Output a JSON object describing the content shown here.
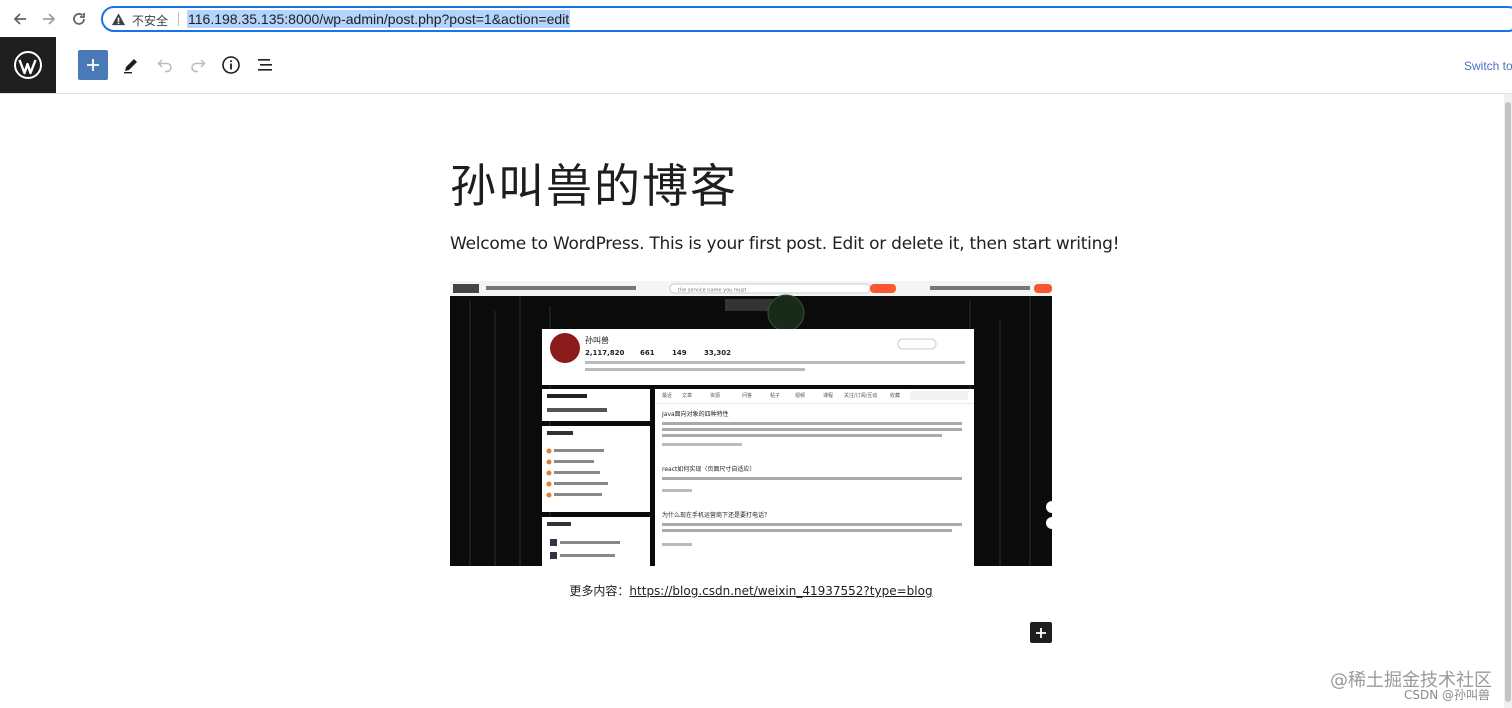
{
  "browser": {
    "security_label": "不安全",
    "url": "116.198.35.135:8000/wp-admin/post.php?post=1&action=edit"
  },
  "toolbar": {
    "switch_label": "Switch to"
  },
  "post": {
    "title": "孙叫兽的博客",
    "paragraph": "Welcome to WordPress. This is your first post. Edit or delete it, then start writing!",
    "caption_prefix": "更多内容：",
    "caption_link": "https://blog.csdn.net/weixin_41937552?type=blog"
  },
  "screenshot": {
    "search_placeholder": "the service name you must",
    "profile_name": "孙叫兽",
    "stats": [
      "2,117,820",
      "661",
      "149",
      "33,302"
    ],
    "tabs": [
      "最近",
      "文章",
      "资源",
      "问答",
      "帖子",
      "视频",
      "课程",
      "关注/订阅/互动",
      "收藏"
    ],
    "article_titles": [
      "Java面向对象的四种特性",
      "react如何实现（页面尺寸自适应）",
      "为什么现在手机运营商下还是要打电话？"
    ]
  },
  "watermarks": {
    "line1": "@稀土掘金技术社区",
    "line2": "CSDN @孙叫兽"
  },
  "colors": {
    "accent": "#3858e9",
    "wp_dark": "#1e1e1e"
  }
}
